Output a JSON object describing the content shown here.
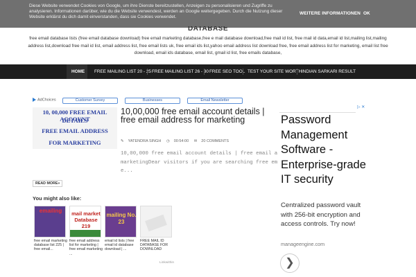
{
  "cookie": {
    "text": "Diese Website verwendet Cookies von Google, um ihre Dienste bereitzustellen, Anzeigen zu personalisieren und Zugriffe zu analysieren. Informationen darüber, wie du die Website verwendest, werden an Google weitergegeben. Durch die Nutzung dieser Website erklärst du dich damit einverstanden, dass sie Cookies verwendet.",
    "more_label": "WEITERE INFORMATIONEN",
    "ok_label": "OK"
  },
  "header": {
    "title": "DATABASE",
    "description": "free email database lists (free email database download) free email marketing database,free e mail database download,free mail id list, free mail id data,email id list,mailing list,mailing address list,download free mail id list, email address list, free email lists uk, free email ids list,yahoo email address list download free, free email address list for marketing, email list free download, email ids database, email list, gmail id list, free emails database,"
  },
  "nav": {
    "items": [
      {
        "label": "HOME",
        "active": true
      },
      {
        "label": "FREE MAILING LIST 20 - 25"
      },
      {
        "label": "FREE MAILING LIST 26 - 30"
      },
      {
        "label": "FREE SEO TOOL"
      },
      {
        "label": "TEST YOUR SITE WORTH"
      },
      {
        "label": "INDIAN SARKARI RESULT"
      }
    ]
  },
  "ad_strip": {
    "adchoices": "AdChoices",
    "buttons": [
      "Customer Survey",
      "Businesses",
      "Email Newsletter"
    ]
  },
  "post": {
    "thumb_lines": [
      "10, 00,000 FREE EMAIL ACCOUNT",
      "DETAILS",
      "FREE EMAIL ADDRESS",
      "FOR MARKETING"
    ],
    "title": "10,00,000 free email account details | free email address for marketing",
    "author": "YATENDRA SINGH",
    "time": "00:54:00",
    "comments": "20 COMMENTS",
    "snippet_lines": [
      "10,00,000 free email account details | free email ad",
      "marketingDear visitors if you are searching free emai",
      "e..."
    ],
    "read_more": "READ MORE»"
  },
  "related": {
    "title": "You might also like:",
    "items": [
      {
        "caption": "free email marketing database list 225 | free email..."
      },
      {
        "caption": "free email address list for marketing | free email marketing ..."
      },
      {
        "caption": "email id lists | free email id database download | ..."
      },
      {
        "caption": "FREE MAIL ID DATABASE FOR DOWNLOAD"
      }
    ],
    "thumb_texts": [
      "emailing",
      "mail market Database 219",
      "mailing No. 23",
      ""
    ],
    "footer": "Linkwithin"
  },
  "right_ad": {
    "title": "Password Management Software - Enterprise-grade IT security",
    "body": "Centralized password vault with 256-bit encryption and access controls. Try now!",
    "domain": "manageengine.com",
    "arrow": "❯"
  }
}
